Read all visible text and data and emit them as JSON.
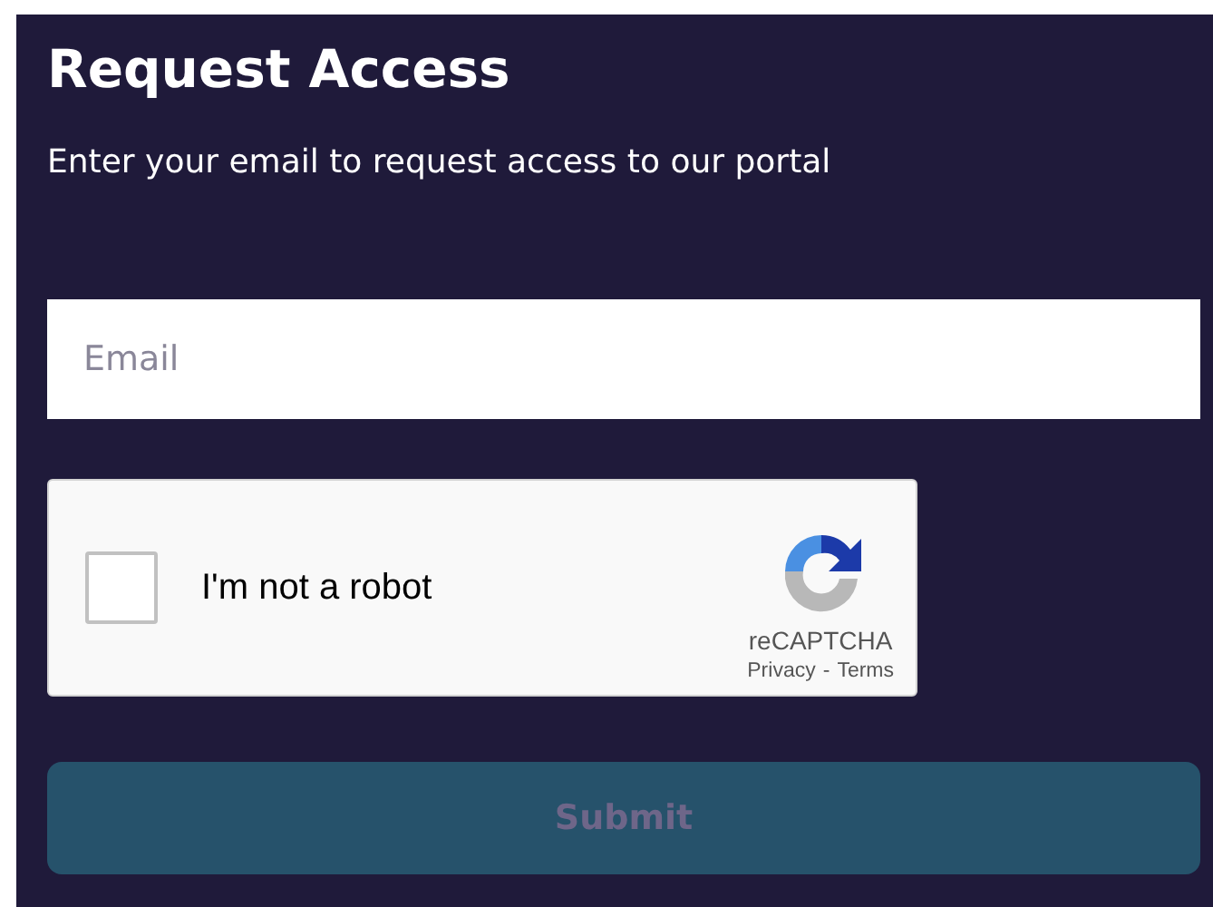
{
  "title": "Request Access",
  "subtitle": "Enter your email to request access to our portal",
  "email": {
    "placeholder": "Email"
  },
  "captcha": {
    "label": "I'm not a robot",
    "checked": false,
    "brand": "reCAPTCHA",
    "privacy": "Privacy",
    "separator": "-",
    "terms": "Terms"
  },
  "submit": {
    "label": "Submit",
    "disabled": true
  }
}
